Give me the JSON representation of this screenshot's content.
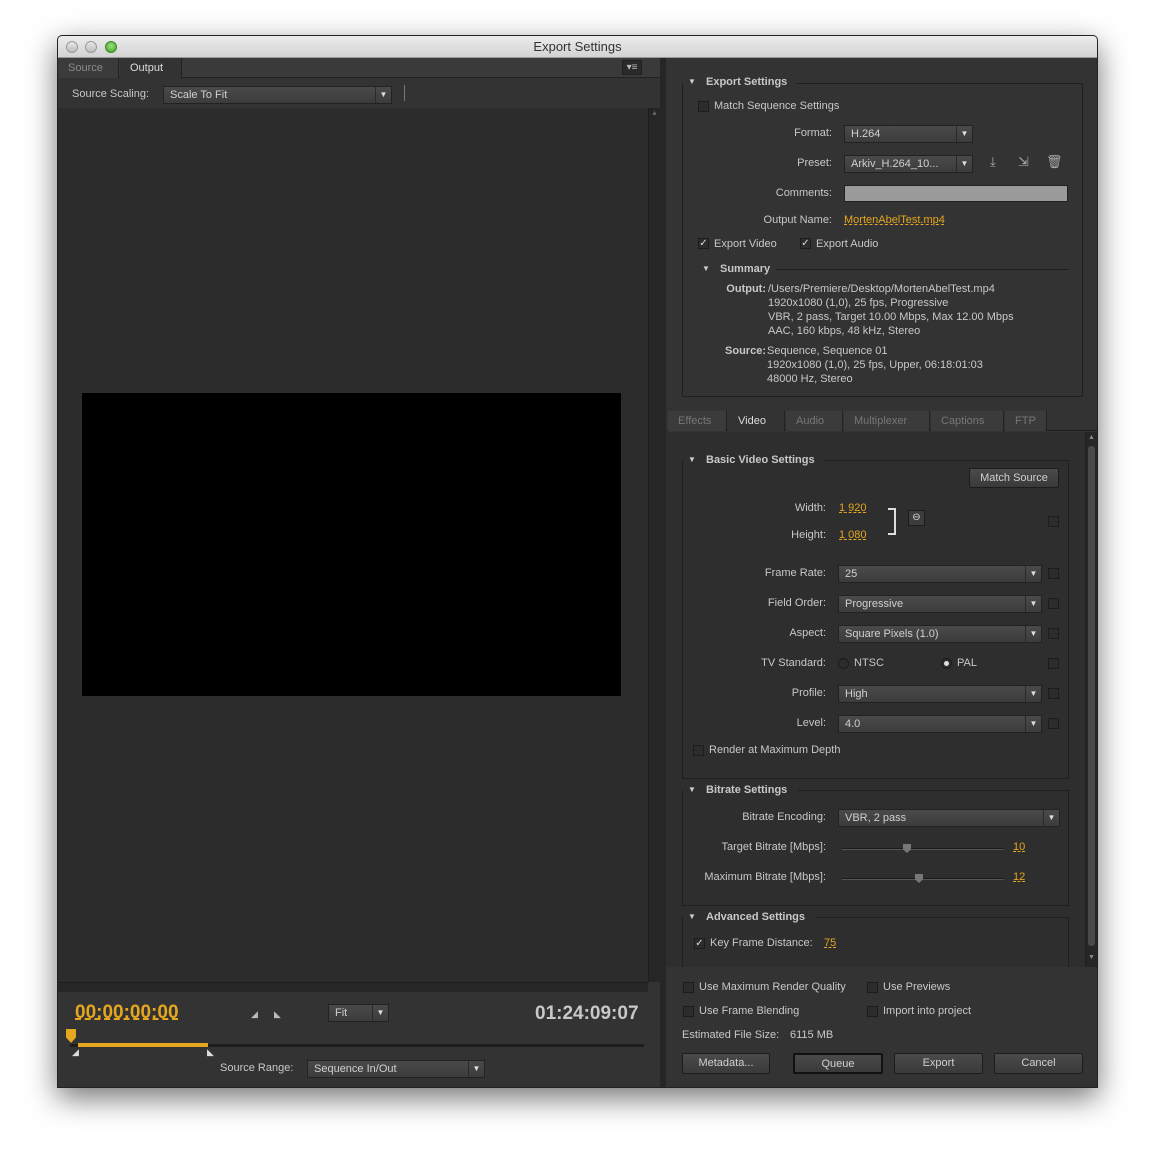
{
  "window": {
    "title": "Export Settings"
  },
  "left": {
    "tabs": [
      "Source",
      "Output"
    ],
    "source_scaling_label": "Source Scaling:",
    "source_scaling_value": "Scale To Fit",
    "timecode_current": "00:00:00:00",
    "timecode_duration": "01:24:09:07",
    "zoom_value": "Fit",
    "source_range_label": "Source Range:",
    "source_range_value": "Sequence In/Out"
  },
  "export": {
    "header": "Export Settings",
    "match_sequence": "Match Sequence Settings",
    "format_label": "Format:",
    "format_value": "H.264",
    "preset_label": "Preset:",
    "preset_value": "Arkiv_H.264_10...",
    "comments_label": "Comments:",
    "output_name_label": "Output Name:",
    "output_name_value": "MortenAbelTest.mp4",
    "export_video": "Export Video",
    "export_audio": "Export Audio",
    "summary_header": "Summary",
    "output_label": "Output:",
    "output_lines": [
      "/Users/Premiere/Desktop/MortenAbelTest.mp4",
      "1920x1080 (1,0), 25 fps, Progressive",
      "VBR, 2 pass, Target 10.00 Mbps, Max 12.00 Mbps",
      "AAC, 160 kbps, 48 kHz, Stereo"
    ],
    "source_label": "Source:",
    "source_lines": [
      "Sequence, Sequence 01",
      "1920x1080 (1,0), 25 fps, Upper, 06:18:01:03",
      "48000 Hz, Stereo"
    ]
  },
  "tabs": [
    "Effects",
    "Video",
    "Audio",
    "Multiplexer",
    "Captions",
    "FTP"
  ],
  "video": {
    "basic_header": "Basic Video Settings",
    "match_source": "Match Source",
    "width_label": "Width:",
    "width_value": "1 920",
    "height_label": "Height:",
    "height_value": "1 080",
    "frame_rate_label": "Frame Rate:",
    "frame_rate_value": "25",
    "field_order_label": "Field Order:",
    "field_order_value": "Progressive",
    "aspect_label": "Aspect:",
    "aspect_value": "Square Pixels (1.0)",
    "tv_standard_label": "TV Standard:",
    "ntsc": "NTSC",
    "pal": "PAL",
    "profile_label": "Profile:",
    "profile_value": "High",
    "level_label": "Level:",
    "level_value": "4.0",
    "render_max_depth": "Render at Maximum Depth",
    "bitrate_header": "Bitrate Settings",
    "bitrate_encoding_label": "Bitrate Encoding:",
    "bitrate_encoding_value": "VBR, 2 pass",
    "target_bitrate_label": "Target Bitrate [Mbps]:",
    "target_bitrate_value": "10",
    "max_bitrate_label": "Maximum Bitrate [Mbps]:",
    "max_bitrate_value": "12",
    "advanced_header": "Advanced Settings",
    "key_frame_label": "Key Frame Distance:",
    "key_frame_value": "75"
  },
  "bottom": {
    "max_render_quality": "Use Maximum Render Quality",
    "use_previews": "Use Previews",
    "frame_blending": "Use Frame Blending",
    "import_project": "Import into project",
    "file_size_label": "Estimated File Size:",
    "file_size_value": "6115 MB",
    "metadata_btn": "Metadata...",
    "queue_btn": "Queue",
    "export_btn": "Export",
    "cancel_btn": "Cancel"
  },
  "colors": {
    "accent": "#e5a620",
    "background": "#323232",
    "panel": "#2b2b2b"
  }
}
